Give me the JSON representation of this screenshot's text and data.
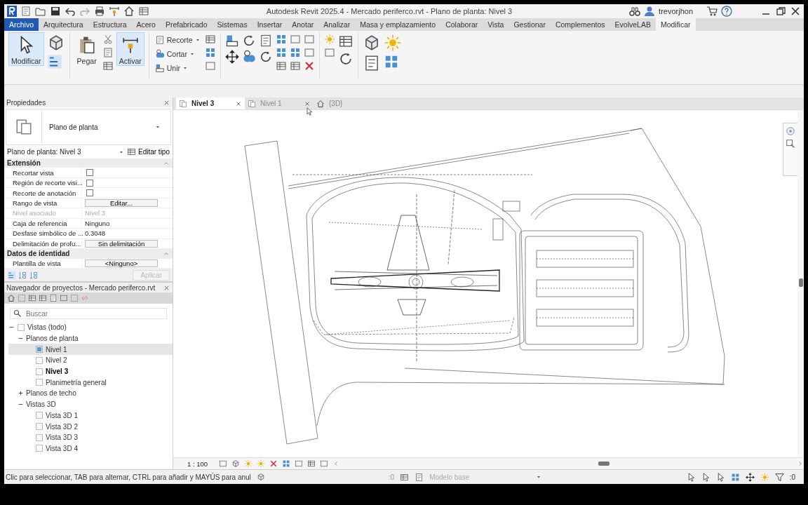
{
  "window": {
    "title": "Autodesk Revit 2025.4 - Mercado periferco.rvt - Plano de planta: Nivel 3",
    "user": "trevorjhon"
  },
  "ribbon_tabs": [
    {
      "label": "Archivo",
      "kind": "file",
      "selected": false
    },
    {
      "label": "Arquitectura",
      "kind": "tab",
      "selected": false
    },
    {
      "label": "Estructura",
      "kind": "tab",
      "selected": false
    },
    {
      "label": "Acero",
      "kind": "tab",
      "selected": false
    },
    {
      "label": "Prefabricado",
      "kind": "tab",
      "selected": false
    },
    {
      "label": "Sistemas",
      "kind": "tab",
      "selected": false
    },
    {
      "label": "Insertar",
      "kind": "tab",
      "selected": false
    },
    {
      "label": "Anotar",
      "kind": "tab",
      "selected": false
    },
    {
      "label": "Analizar",
      "kind": "tab",
      "selected": false
    },
    {
      "label": "Masa y emplazamiento",
      "kind": "tab",
      "selected": false
    },
    {
      "label": "Colaborar",
      "kind": "tab",
      "selected": false
    },
    {
      "label": "Vista",
      "kind": "tab",
      "selected": false
    },
    {
      "label": "Gestionar",
      "kind": "tab",
      "selected": false
    },
    {
      "label": "Complementos",
      "kind": "tab",
      "selected": false
    },
    {
      "label": "EvolveLAB",
      "kind": "tab",
      "selected": false
    },
    {
      "label": "Modificar",
      "kind": "tab",
      "selected": true
    }
  ],
  "ribbon": {
    "select_button": {
      "label": "Modificar",
      "on": true
    },
    "paste_button": {
      "label": "Pegar",
      "on": false
    },
    "activate_button": {
      "label": "Activar",
      "on": true
    },
    "geometry_buttons": [
      "Recorte",
      "Cortar",
      "Unir"
    ]
  },
  "properties": {
    "title": "Propiedades",
    "type": "Plano de planta",
    "instance": "Plano de planta: Nivel 3",
    "edit_type": "Editar tipo",
    "groups": [
      {
        "title": "Extensión",
        "rows": [
          {
            "label": "Recortar vista",
            "kind": "checkbox",
            "checked": false,
            "disabled": false
          },
          {
            "label": "Región de recorte visi...",
            "kind": "checkbox",
            "checked": false,
            "disabled": false
          },
          {
            "label": "Recorte de anotación",
            "kind": "checkbox",
            "checked": false,
            "disabled": false
          },
          {
            "label": "Rango de vista",
            "kind": "button",
            "value": "Editar...",
            "disabled": false
          },
          {
            "label": "Nivel asociado",
            "kind": "text",
            "value": "Nivel 3",
            "disabled": true
          },
          {
            "label": "Caja de referencia",
            "kind": "text",
            "value": "Ninguno",
            "disabled": false
          },
          {
            "label": "Desfase simbólico de ...",
            "kind": "text",
            "value": "0.3048",
            "disabled": false
          },
          {
            "label": "Delimitación de profu...",
            "kind": "button",
            "value": "Sin delimitación",
            "disabled": false
          }
        ]
      },
      {
        "title": "Datos de identidad",
        "rows": [
          {
            "label": "Plantilla de vista",
            "kind": "button",
            "value": "<Ninguno>",
            "disabled": false
          }
        ]
      }
    ],
    "apply_button": {
      "label": "Aplicar",
      "disabled": true
    }
  },
  "project_browser": {
    "title": "Navegador de proyectos - Mercado periferco.rvt",
    "search": {
      "placeholder": "Buscar"
    },
    "tree": [
      {
        "label": "Vistas (todo)",
        "expanded": true,
        "selected": false,
        "active": false,
        "children": [
          {
            "label": "Planos de planta",
            "expanded": true,
            "selected": false,
            "active": false,
            "children": [
              {
                "label": "Nivel 1",
                "selected": true,
                "active": false
              },
              {
                "label": "Nivel 2",
                "selected": false,
                "active": false
              },
              {
                "label": "Nivel 3",
                "selected": false,
                "active": true
              },
              {
                "label": "Planimetría general",
                "selected": false,
                "active": false
              }
            ]
          },
          {
            "label": "Planos de techo",
            "expanded": false,
            "selected": false,
            "active": false
          },
          {
            "label": "Vistas 3D",
            "expanded": true,
            "selected": false,
            "active": false,
            "children": [
              {
                "label": "Vista 3D 1",
                "selected": false,
                "active": false
              },
              {
                "label": "Vista 3D 2",
                "selected": false,
                "active": false
              },
              {
                "label": "Vista 3D 3",
                "selected": false,
                "active": false
              },
              {
                "label": "Vista 3D 4",
                "selected": false,
                "active": false
              }
            ]
          }
        ]
      }
    ]
  },
  "view_tabs": [
    {
      "label": "Nivel 3",
      "kind": "plan",
      "selected": true,
      "closable": true
    },
    {
      "label": "Nivel 1",
      "kind": "plan",
      "selected": false,
      "closable": true
    },
    {
      "label": "{3D}",
      "kind": "model",
      "selected": false,
      "closable": false
    }
  ],
  "view_control_bar": {
    "scale": "1 : 100"
  },
  "status_bar": {
    "message": "Clic para seleccionar, TAB para alternar, CTRL para añadir y MAYÚS para anul",
    "selection_count": ":0",
    "model": "Modelo base",
    "filter_count": ":0"
  }
}
